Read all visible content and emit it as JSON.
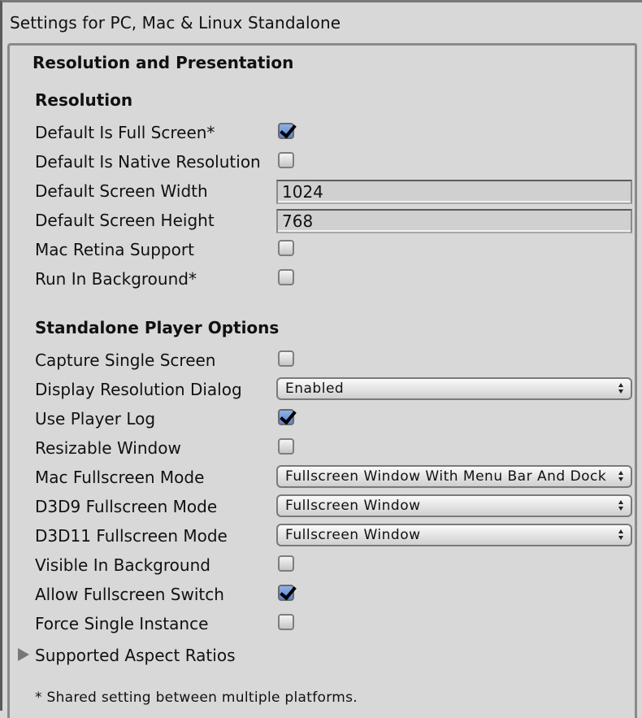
{
  "window_title": "Settings for PC, Mac & Linux Standalone",
  "section": {
    "title": "Resolution and Presentation",
    "groups": [
      {
        "title": "Resolution",
        "rows": [
          {
            "label": "Default Is Full Screen*",
            "type": "checkbox",
            "checked": true
          },
          {
            "label": "Default Is Native Resolution",
            "type": "checkbox",
            "checked": false
          },
          {
            "label": "Default Screen Width",
            "type": "text",
            "value": "1024"
          },
          {
            "label": "Default Screen Height",
            "type": "text",
            "value": "768"
          },
          {
            "label": "Mac Retina Support",
            "type": "checkbox",
            "checked": false
          },
          {
            "label": "Run In Background*",
            "type": "checkbox",
            "checked": false
          }
        ]
      },
      {
        "title": "Standalone Player Options",
        "rows": [
          {
            "label": "Capture Single Screen",
            "type": "checkbox",
            "checked": false
          },
          {
            "label": "Display Resolution Dialog",
            "type": "dropdown",
            "value": "Enabled"
          },
          {
            "label": "Use Player Log",
            "type": "checkbox",
            "checked": true
          },
          {
            "label": "Resizable Window",
            "type": "checkbox",
            "checked": false
          },
          {
            "label": "Mac Fullscreen Mode",
            "type": "dropdown",
            "value": "Fullscreen Window With Menu Bar And Dock"
          },
          {
            "label": "D3D9 Fullscreen Mode",
            "type": "dropdown",
            "value": "Fullscreen Window"
          },
          {
            "label": "D3D11 Fullscreen Mode",
            "type": "dropdown",
            "value": "Fullscreen Window"
          },
          {
            "label": "Visible In Background",
            "type": "checkbox",
            "checked": false
          },
          {
            "label": "Allow Fullscreen Switch",
            "type": "checkbox",
            "checked": true
          },
          {
            "label": "Force Single Instance",
            "type": "checkbox",
            "checked": false
          }
        ]
      }
    ],
    "foldout": {
      "label": "Supported Aspect Ratios",
      "expanded": false
    },
    "footnote": "* Shared setting between multiple platforms."
  },
  "colors": {
    "background": "#d8d8d8",
    "checkbox_checked": "#6f95d8",
    "border": "#8a8a8a"
  }
}
